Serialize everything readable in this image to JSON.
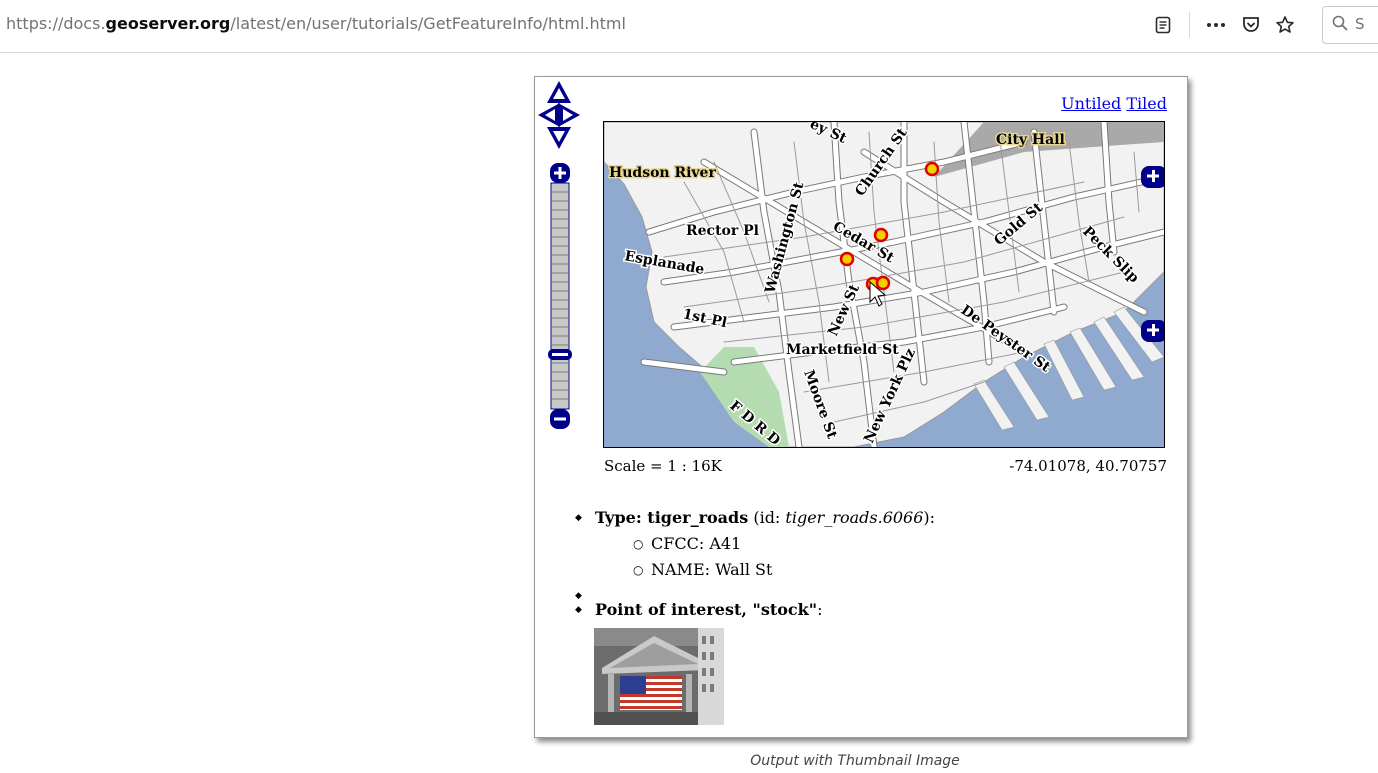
{
  "browser": {
    "url_prefix": "https://docs.",
    "url_domain": "geoserver.org",
    "url_path": "/latest/en/user/tutorials/GetFeatureInfo/html.html",
    "reader_icon": "reader-view-icon",
    "menu_icon": "more-actions-icon",
    "pocket_icon": "pocket-icon",
    "bookmark_icon": "star-icon",
    "search_icon": "search-icon",
    "search_placeholder": "S"
  },
  "map_header": {
    "untiled_label": "Untiled",
    "tiled_label": "Tiled"
  },
  "map": {
    "labels": {
      "city_hall": "City Hall",
      "hudson_river": "Hudson River",
      "rector_pl": "Rector Pl",
      "esplanade": "Esplanade",
      "first_pl": "1st Pl",
      "marketfield_st": "Marketfield St",
      "church_st": "Church St",
      "cedar_st": "Cedar St",
      "washington_st": "Washington St",
      "new_st": "New St",
      "gold_st": "Gold St",
      "peck_slip": "Peck Slip",
      "de_peyster_st": "De Peyster St",
      "moore_st": "Moore St",
      "new_york_plz": "New York Plz",
      "fdr_dr": "F D R D",
      "top_st": "ey St"
    },
    "colors": {
      "water": "#8fa9cf",
      "land": "#f2f2f2",
      "park": "#b5dbb0",
      "road": "#ffffff",
      "road_casing": "#808080",
      "poi_fill": "#f5d000",
      "poi_stroke": "#e00000",
      "control_blue": "#00008b"
    }
  },
  "scale_label": "Scale = 1 : 16K",
  "coords_label": "-74.01078, 40.70757",
  "feature_info": {
    "type_label": "Type",
    "type_value": "tiger_roads",
    "id_prefix": "(id:",
    "id_value": "tiger_roads.6066",
    "id_suffix": "):",
    "attributes": [
      {
        "key": "CFCC",
        "value": "A41"
      },
      {
        "key": "NAME",
        "value": "Wall St"
      }
    ],
    "poi_label": "Point of interest, \"stock\"",
    "poi_suffix": ":",
    "thumbnail_name": "stock-exchange-thumbnail"
  },
  "caption": "Output with Thumbnail Image"
}
